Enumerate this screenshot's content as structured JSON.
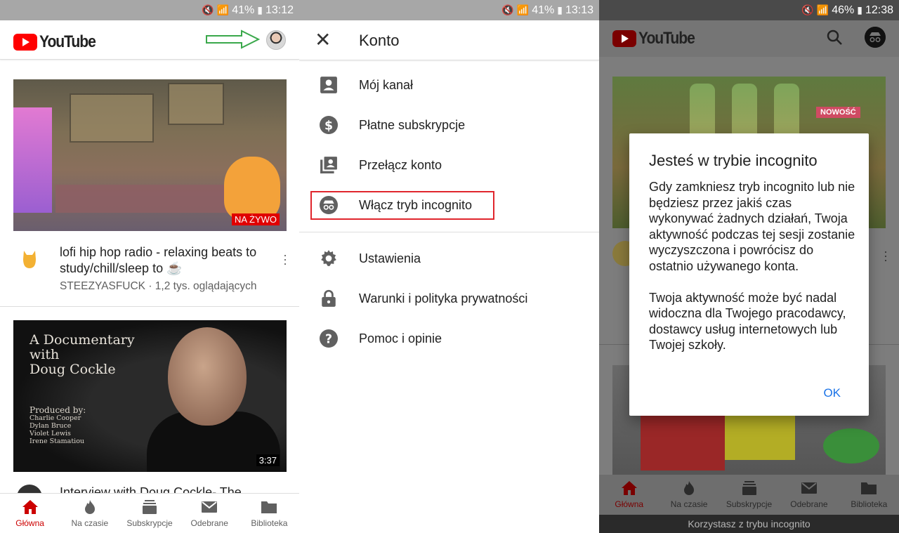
{
  "panel1": {
    "status": {
      "battery": "41%",
      "time": "13:12"
    },
    "brand": "YouTube",
    "videos": [
      {
        "title": "lofi hip hop radio - relaxing beats to study/chill/sleep to ☕",
        "subtitle": "STEEZYASFUCK · 1,2 tys. oglądających",
        "badge": "NA ŻYWO"
      },
      {
        "title": "Interview with Doug Cockle- The",
        "badge": "3:37",
        "thumb_title": "A Documentary\nwith\nDoug Cockle",
        "thumb_credits_heading": "Produced by:",
        "thumb_credits": [
          "Charlie Cooper",
          "Dylan Bruce",
          "Violet Lewis",
          "Irene Stamatiou"
        ]
      }
    ],
    "nav": [
      {
        "label": "Główna",
        "icon": "home-icon"
      },
      {
        "label": "Na czasie",
        "icon": "flame-icon"
      },
      {
        "label": "Subskrypcje",
        "icon": "subscriptions-icon"
      },
      {
        "label": "Odebrane",
        "icon": "mail-icon"
      },
      {
        "label": "Biblioteka",
        "icon": "folder-icon"
      }
    ],
    "accent": "#cc0000",
    "arrow_color": "#3aa84b"
  },
  "panel2": {
    "status": {
      "battery": "41%",
      "time": "13:13"
    },
    "title": "Konto",
    "items": [
      {
        "label": "Mój kanał",
        "icon": "account-box-icon"
      },
      {
        "label": "Płatne subskrypcje",
        "icon": "dollar-circle-icon"
      },
      {
        "label": "Przełącz konto",
        "icon": "switch-account-icon"
      },
      {
        "label": "Włącz tryb incognito",
        "icon": "incognito-icon"
      },
      {
        "label": "Ustawienia",
        "icon": "gear-icon"
      },
      {
        "label": "Warunki i polityka prywatności",
        "icon": "lock-icon"
      },
      {
        "label": "Pomoc i opinie",
        "icon": "help-icon"
      }
    ],
    "highlight_color": "#e0262d"
  },
  "panel3": {
    "status": {
      "battery": "46%",
      "time": "12:38"
    },
    "brand": "YouTube",
    "thumb_badge": "NOWOŚĆ",
    "dialog": {
      "title": "Jesteś w trybie incognito",
      "p1": "Gdy zamkniesz tryb incognito lub nie będziesz przez jakiś czas wykonywać żadnych działań, Twoja aktywność podczas tej sesji zostanie wyczyszczona i powrócisz do ostatnio używanego konta.",
      "p2": "Twoja aktywność może być nadal widoczna dla Twojego pracodawcy, dostawcy usług internetowych lub Twojej szkoły.",
      "ok": "OK"
    },
    "nav": [
      {
        "label": "Główna"
      },
      {
        "label": "Na czasie"
      },
      {
        "label": "Subskrypcje"
      },
      {
        "label": "Odebrane"
      },
      {
        "label": "Biblioteka"
      }
    ],
    "incognito_banner": "Korzystasz z trybu incognito"
  }
}
